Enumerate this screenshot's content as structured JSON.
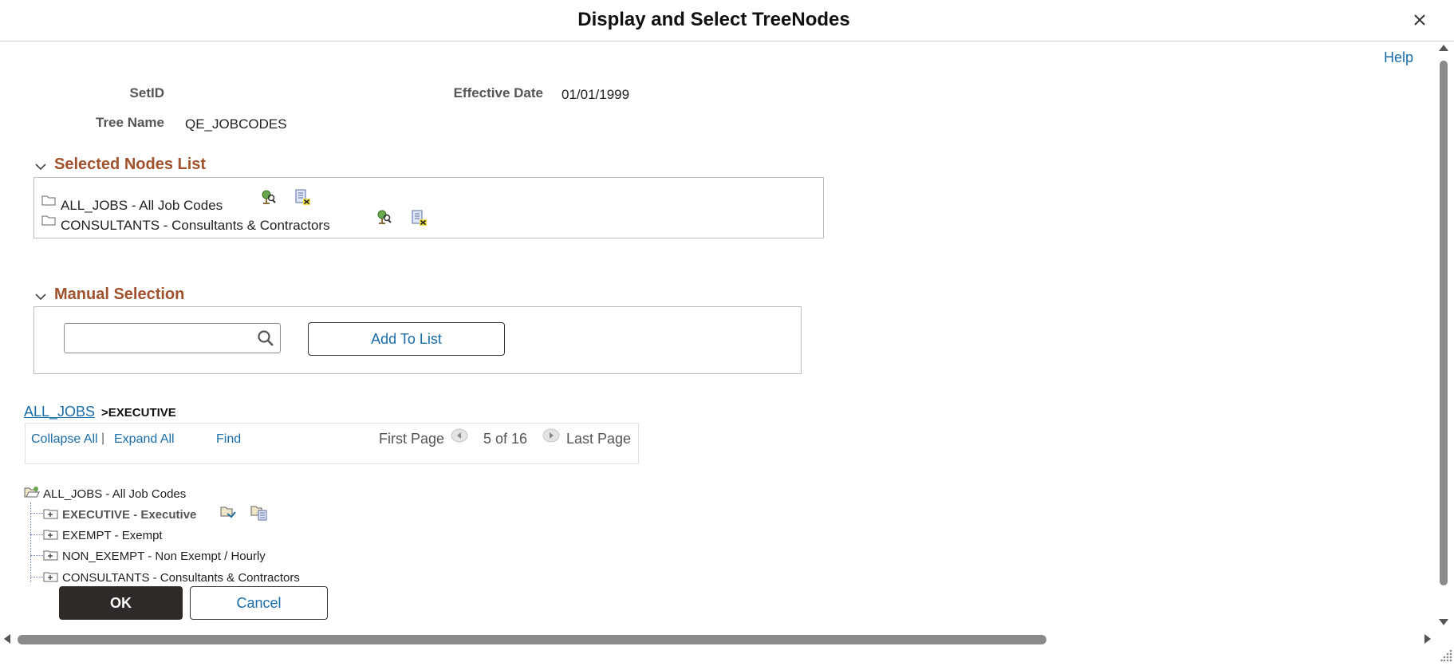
{
  "header": {
    "title": "Display and Select TreeNodes",
    "help_label": "Help"
  },
  "fields": {
    "setid_label": "SetID",
    "setid_value": "",
    "effective_date_label": "Effective Date",
    "effective_date_value": "01/01/1999",
    "tree_name_label": "Tree Name",
    "tree_name_value": "QE_JOBCODES"
  },
  "selected_nodes": {
    "heading": "Selected Nodes List",
    "items": [
      {
        "label": "ALL_JOBS - All Job Codes"
      },
      {
        "label": "CONSULTANTS - Consultants & Contractors"
      }
    ]
  },
  "manual_selection": {
    "heading": "Manual Selection",
    "search_value": "",
    "add_button": "Add To List"
  },
  "breadcrumb": {
    "root": "ALL_JOBS",
    "current": ">EXECUTIVE"
  },
  "nav": {
    "collapse_all": "Collapse All",
    "separator": "|",
    "expand_all": "Expand All",
    "find": "Find",
    "first_page": "First Page",
    "page_status": "5 of 16",
    "last_page": "Last Page"
  },
  "tree": {
    "root": "ALL_JOBS - All Job Codes",
    "children": [
      {
        "label": "EXECUTIVE - Executive",
        "selected": true
      },
      {
        "label": "EXEMPT - Exempt"
      },
      {
        "label": "NON_EXEMPT - Non Exempt / Hourly"
      },
      {
        "label": "CONSULTANTS - Consultants & Contractors"
      }
    ]
  },
  "footer": {
    "ok": "OK",
    "cancel": "Cancel"
  },
  "colors": {
    "section_heading": "#a0522d",
    "link": "#1a6ca8",
    "ok_button": "#2d2a28"
  }
}
